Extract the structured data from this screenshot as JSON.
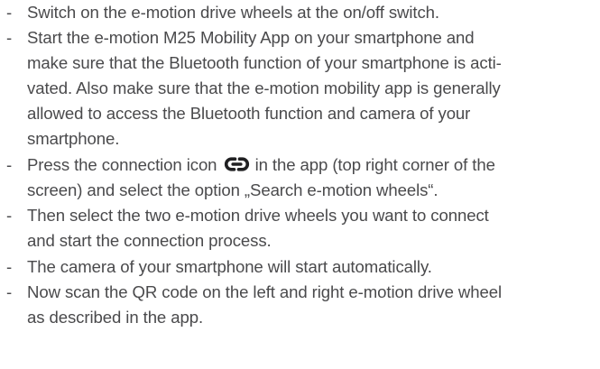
{
  "bullet_marker": "-",
  "instructions": [
    {
      "lines": [
        "Switch on the e-motion drive wheels at the on/off switch."
      ]
    },
    {
      "lines": [
        "Start the e-motion M25 Mobility App on your smartphone and",
        "make sure that the Bluetooth function of your smartphone is acti-",
        "vated. Also make sure that the e-motion mobility app is generally",
        "allowed to access the Bluetooth function and camera of your",
        "smartphone."
      ]
    },
    {
      "first_line_before_icon": "Press the connection icon",
      "icon": "link-chain-icon",
      "first_line_after_icon": "in the app (top right corner of the",
      "lines": [
        "screen) and select the option „Search e-motion wheels“."
      ]
    },
    {
      "lines": [
        "Then select the two e-motion drive wheels you want to connect",
        "and start the connection process."
      ]
    },
    {
      "lines": [
        "The camera of your smartphone will start automatically."
      ]
    },
    {
      "lines": [
        "Now scan the QR code on the left and right e-motion drive wheel",
        "as described in the app."
      ]
    }
  ]
}
